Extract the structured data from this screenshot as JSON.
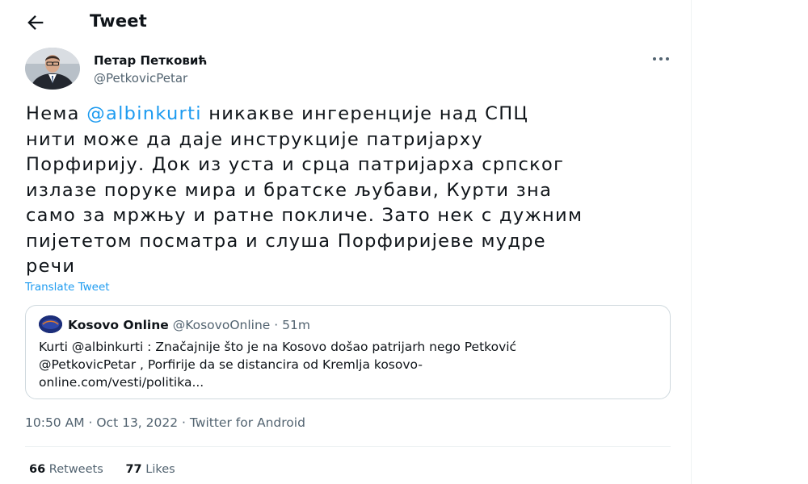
{
  "header": {
    "title": "Tweet"
  },
  "author": {
    "name": "Петар Петковић",
    "handle": "@PetkovicPetar"
  },
  "tweet": {
    "lines": [
      {
        "before": "Нема ",
        "mention": "@albinkurti",
        "after": " никакве ингеренције над СПЦ"
      },
      {
        "text": "нити може да даје инструкције патријарху"
      },
      {
        "text": "Порфирију. Док из уста и срца патријарха српског"
      },
      {
        "text": "излазе поруке мира и братске љубави, Курти зна"
      },
      {
        "text": "само за мржњу и ратне покличе. Зато нек с дужним"
      },
      {
        "text": "пијететом посматра и слуша Порфиријеве мудре"
      },
      {
        "text": "речи"
      }
    ],
    "translate_label": "Translate Tweet"
  },
  "quote": {
    "name": "Kosovo Online",
    "handle": "@KosovoOnline",
    "separator": " · ",
    "time": "51m",
    "lines": [
      "Kurti @albinkurti : Značajnije što je na Kosovo došao patrijarh nego Petković",
      "@PetkovicPetar , Porfirije da se distancira od Kremlja  kosovo-",
      "online.com/vesti/politika..."
    ]
  },
  "meta": {
    "time": "10:50 AM",
    "date": "Oct 13, 2022",
    "separator": " · ",
    "source": "Twitter for Android"
  },
  "stats": {
    "retweets_count": "66",
    "retweets_label": " Retweets",
    "likes_count": "77",
    "likes_label": " Likes"
  },
  "colors": {
    "accent": "#1d9bf0",
    "secondary_text": "#536471",
    "border": "#cfd9de"
  },
  "icons": {
    "back": "arrow-left-icon",
    "more": "more-horizontal-icon"
  }
}
